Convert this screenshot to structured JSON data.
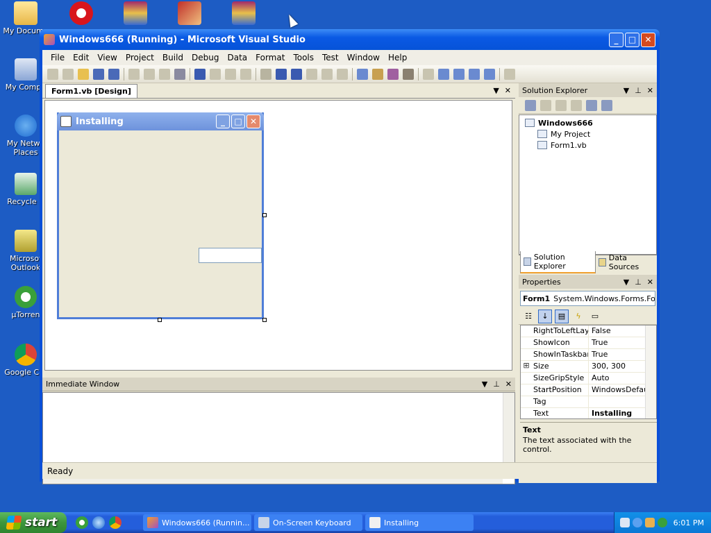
{
  "desktop": {
    "icons": [
      {
        "label": "My Docume",
        "icon": "folder-icon"
      },
      {
        "label": "My Compu",
        "icon": "computer-icon"
      },
      {
        "label": "My Netwo Places",
        "icon": "network-icon"
      },
      {
        "label": "Recycle B",
        "icon": "recycle-bin-icon"
      },
      {
        "label": "Microsof Outlook",
        "icon": "outlook-icon"
      },
      {
        "label": "µTorren",
        "icon": "utorrent-icon"
      },
      {
        "label": "Google Chr",
        "icon": "chrome-icon"
      }
    ]
  },
  "window": {
    "title": "Windows666 (Running) - Microsoft Visual Studio"
  },
  "menu": [
    "File",
    "Edit",
    "View",
    "Project",
    "Build",
    "Debug",
    "Data",
    "Format",
    "Tools",
    "Test",
    "Window",
    "Help"
  ],
  "designer": {
    "tab": "Form1.vb [Design]",
    "form_title": "Installing"
  },
  "immediate": {
    "title": "Immediate Window"
  },
  "solution_explorer": {
    "title": "Solution Explorer",
    "items": [
      "Windows666",
      "My Project",
      "Form1.vb"
    ],
    "tabs": [
      "Solution Explorer",
      "Data Sources"
    ]
  },
  "properties": {
    "title": "Properties",
    "object_name": "Form1",
    "object_type": "System.Windows.Forms.Form",
    "rows": [
      {
        "name": "RightToLeftLayo",
        "value": "False",
        "expand": ""
      },
      {
        "name": "ShowIcon",
        "value": "True",
        "expand": ""
      },
      {
        "name": "ShowInTaskbar",
        "value": "True",
        "expand": ""
      },
      {
        "name": "Size",
        "value": "300, 300",
        "expand": "⊞"
      },
      {
        "name": "SizeGripStyle",
        "value": "Auto",
        "expand": ""
      },
      {
        "name": "StartPosition",
        "value": "WindowsDefaultLo",
        "expand": ""
      },
      {
        "name": "Tag",
        "value": "",
        "expand": ""
      },
      {
        "name": "Text",
        "value": "Installing",
        "expand": ""
      }
    ],
    "desc_title": "Text",
    "desc_text": "The text associated with the control."
  },
  "status": "Ready",
  "taskbar": {
    "start": "start",
    "buttons": [
      "Windows666 (Runnin...",
      "On-Screen Keyboard",
      "Installing"
    ],
    "clock": "6:01 PM"
  }
}
